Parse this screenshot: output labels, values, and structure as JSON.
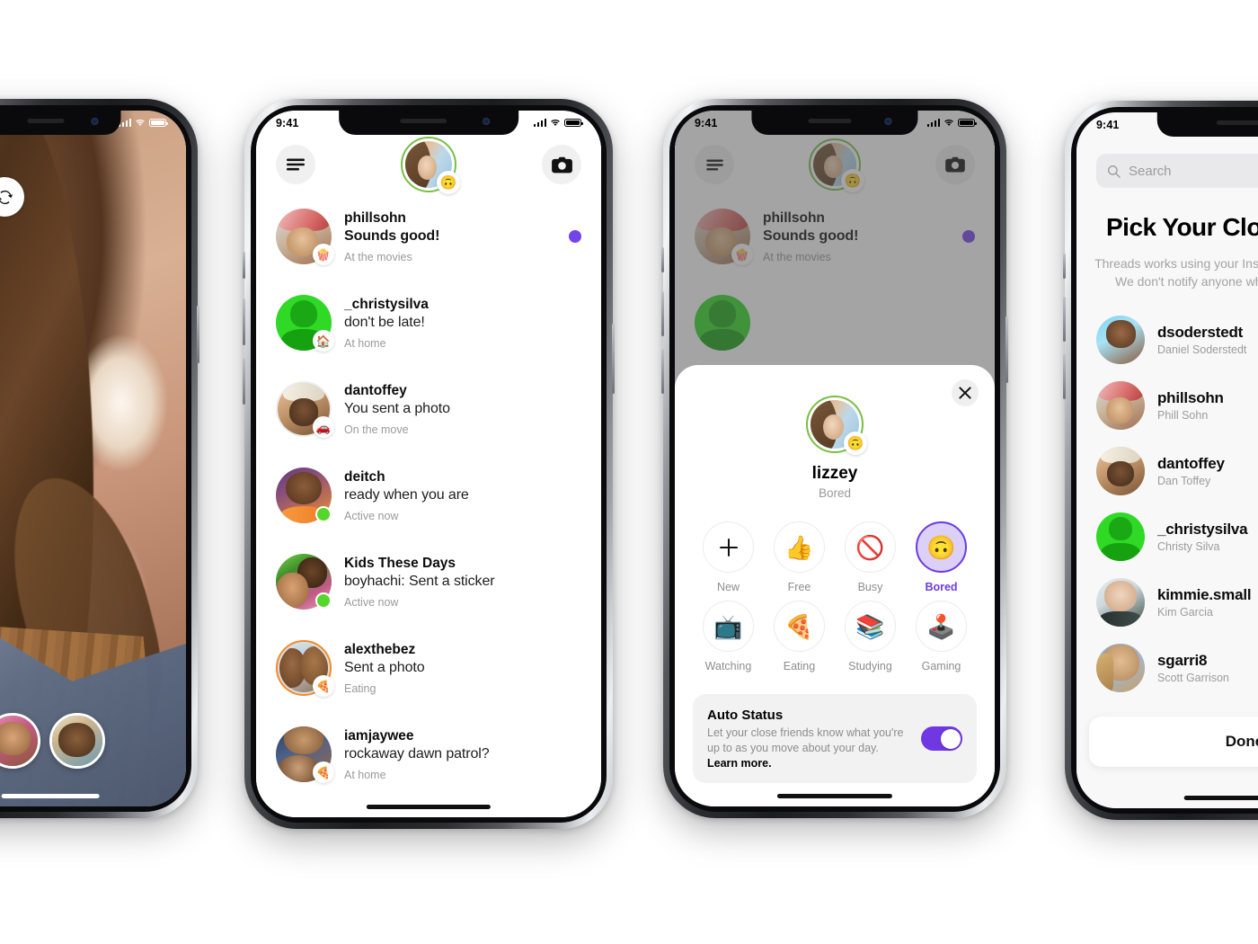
{
  "colors": {
    "accent_purple": "#7344e8",
    "accent_purple_dark": "#6c3be3",
    "toggle_purple": "#7038e2",
    "online_green": "#56d62b",
    "story_ring_green": "#76c043",
    "story_ring_orange": "#f28b2b"
  },
  "status_bar": {
    "time": "9:41",
    "signal_icon": "cellular-bars-icon",
    "wifi_icon": "wifi-icon",
    "battery_icon": "battery-full-icon"
  },
  "phone1": {
    "name": "video-call-screen",
    "buttons": [
      {
        "name": "home-button",
        "icon": "home-icon"
      },
      {
        "name": "flip-camera-button",
        "icon": "camera-flip-icon"
      }
    ],
    "participants": [
      "participant-1",
      "participant-2",
      "participant-3"
    ],
    "page_dots": [
      true,
      false,
      false
    ]
  },
  "phone2": {
    "name": "threads-inbox-screen",
    "header": {
      "menu_button": "hamburger-menu-icon",
      "camera_button": "camera-icon",
      "avatar_name": "lizzey",
      "avatar_status_emoji": "🙃"
    },
    "threads": [
      {
        "user": "phillsohn",
        "message": "Sounds good!",
        "message_bold": true,
        "status": "At the movies",
        "badge_emoji": "🍿",
        "online": false,
        "unread": true,
        "ring": "none",
        "art": "pp-phill"
      },
      {
        "user": "_christysilva",
        "message": "don't be late!",
        "message_bold": false,
        "status": "At home",
        "badge_emoji": "🏠",
        "online": false,
        "unread": false,
        "ring": "none",
        "art": "pp-christy"
      },
      {
        "user": "dantoffey",
        "message": "You sent a photo",
        "message_bold": false,
        "status": "On the move",
        "badge_emoji": "🚗",
        "online": false,
        "unread": false,
        "ring": "light",
        "art": "pp-dan"
      },
      {
        "user": "deitch",
        "message": "ready when you are",
        "message_bold": false,
        "status": "Active now",
        "badge_emoji": "",
        "online": true,
        "unread": false,
        "ring": "none",
        "art": "pp-deitch"
      },
      {
        "user": "Kids These Days",
        "message": "boyhachi: Sent a sticker",
        "message_bold": false,
        "status": "Active now",
        "badge_emoji": "",
        "online": true,
        "unread": false,
        "ring": "none",
        "art": "pp-kids"
      },
      {
        "user": "alexthebez",
        "message": "Sent a photo",
        "message_bold": false,
        "status": "Eating",
        "badge_emoji": "🍕",
        "online": false,
        "unread": false,
        "ring": "orange",
        "art": "pp-alex"
      },
      {
        "user": "iamjaywee",
        "message": "rockaway dawn patrol?",
        "message_bold": false,
        "status": "At home",
        "badge_emoji": "🍕",
        "online": false,
        "unread": false,
        "ring": "none",
        "art": "pp-jay"
      }
    ]
  },
  "phone3": {
    "name": "status-picker-screen",
    "background_thread": {
      "user": "phillsohn",
      "message": "Sounds good!",
      "status": "At the movies",
      "badge_emoji": "🍿"
    },
    "sheet": {
      "close_icon": "close-x-icon",
      "profile_name": "lizzey",
      "profile_status": "Bored",
      "profile_emoji": "🙃",
      "statuses": [
        {
          "label": "New",
          "emoji": "+",
          "is_plus": true,
          "active": false
        },
        {
          "label": "Free",
          "emoji": "👍",
          "is_plus": false,
          "active": false
        },
        {
          "label": "Busy",
          "emoji": "🚫",
          "is_plus": false,
          "active": false
        },
        {
          "label": "Bored",
          "emoji": "🙃",
          "is_plus": false,
          "active": true
        },
        {
          "label": "Watching",
          "emoji": "📺",
          "is_plus": false,
          "active": false
        },
        {
          "label": "Eating",
          "emoji": "🍕",
          "is_plus": false,
          "active": false
        },
        {
          "label": "Studying",
          "emoji": "📚",
          "is_plus": false,
          "active": false
        },
        {
          "label": "Gaming",
          "emoji": "🕹️",
          "is_plus": false,
          "active": false
        }
      ],
      "auto_status": {
        "title": "Auto Status",
        "description": "Let your close friends know what you're up to as you move about your day.",
        "learn_more": "Learn more.",
        "enabled": true
      }
    }
  },
  "phone4": {
    "name": "pick-your-friends-screen",
    "search_placeholder": "Search",
    "search_icon": "search-icon",
    "title": "Pick Your Close Friends",
    "description": "Threads works using your Instagram close friends list. We don't notify anyone when you edit your list.",
    "done_label": "Done",
    "friends": [
      {
        "username": "dsoderstedt",
        "real_name": "Daniel Soderstedt",
        "art": "pp-dsod"
      },
      {
        "username": "phillsohn",
        "real_name": "Phill Sohn",
        "art": "pp-phill"
      },
      {
        "username": "dantoffey",
        "real_name": "Dan Toffey",
        "art": "pp-dan"
      },
      {
        "username": "_christysilva",
        "real_name": "Christy Silva",
        "art": "pp-christy"
      },
      {
        "username": "kimmie.small",
        "real_name": "Kim Garcia",
        "art": "pp-kim"
      },
      {
        "username": "sgarri8",
        "real_name": "Scott Garrison",
        "art": "pp-sgarri"
      }
    ]
  }
}
